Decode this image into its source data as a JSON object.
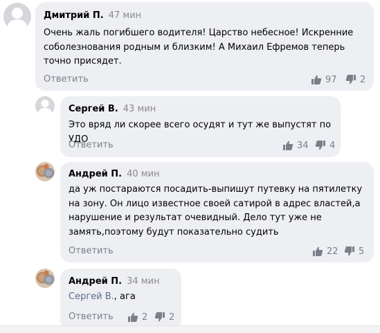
{
  "comments": [
    {
      "author": "Дмитрий П.",
      "time": "47 мин",
      "text": "Очень жаль погибшего водителя! Царство небесное! Искренние соболезнования родным и близким! А Михаил Ефремов теперь точно присядет.",
      "reply_label": "Ответить",
      "likes": "97",
      "dislikes": "2"
    },
    {
      "author": "Сергей В.",
      "time": "43 мин",
      "text": "Это вряд ли скорее всего осудят и тут же выпустят по УДО",
      "reply_label": "Ответить",
      "likes": "34",
      "dislikes": "4"
    },
    {
      "author": "Андрей П.",
      "time": "40 мин",
      "text": "да уж постараются посадить-выпишут путевку на пятилетку на зону. Он лицо известное своей сатирой в адрес властей,а нарушение и результат очевидный. Дело тут уже не замять,поэтому будут показательно судить",
      "reply_label": "Ответить",
      "likes": "22",
      "dislikes": "5"
    },
    {
      "author": "Андрей П.",
      "time": "34 мин",
      "mention": "Сергей В.",
      "text": ", ага",
      "reply_label": "Ответить",
      "likes": "2",
      "dislikes": "2"
    }
  ],
  "icons": {
    "like": "thumbs-up-icon",
    "dislike": "thumbs-down-icon",
    "default_avatar": "user-silhouette-icon",
    "photo_avatar": "coins-photo-avatar"
  }
}
